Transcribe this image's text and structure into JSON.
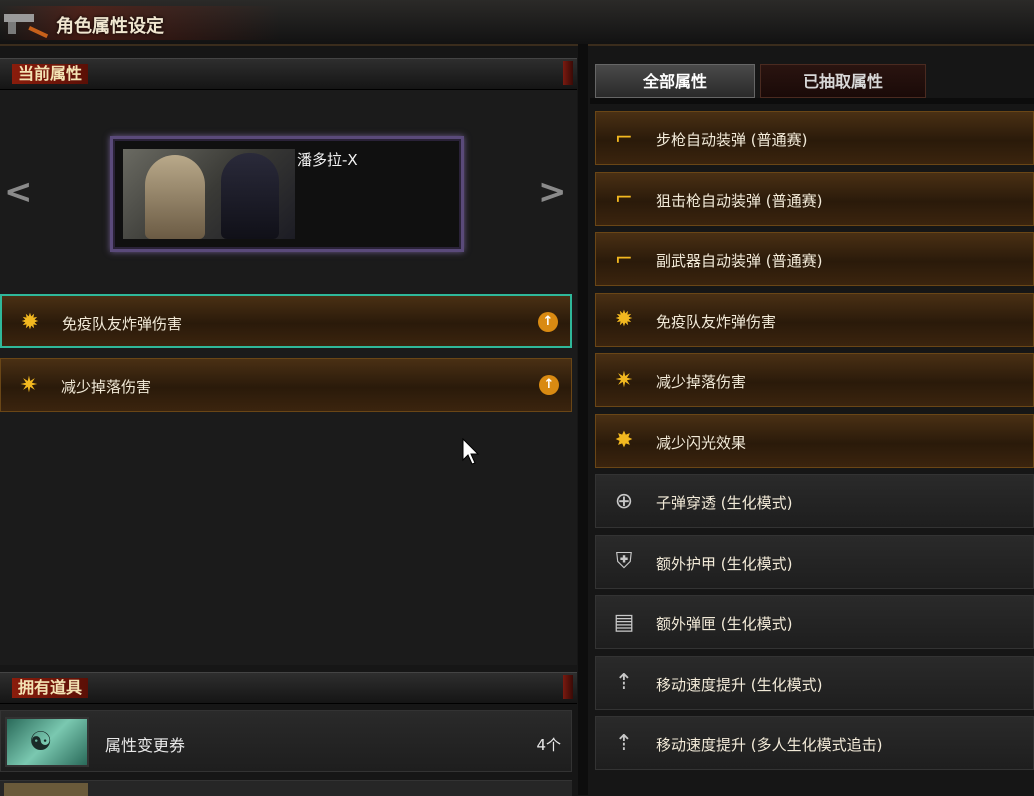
{
  "window": {
    "title": "角色属性设定"
  },
  "current_panel": {
    "header": "当前属性"
  },
  "character": {
    "name": "潘多拉-X",
    "prev_arrow": "<",
    "next_arrow": ">"
  },
  "current_attributes": [
    {
      "label": "免疫队友炸弹伤害",
      "icon": "bomb-burst-icon",
      "upgrade_icon": "upgrade-icon"
    },
    {
      "label": "减少掉落伤害",
      "icon": "fall-damage-icon",
      "upgrade_icon": "upgrade-icon"
    }
  ],
  "tabs": [
    {
      "label": "全部属性",
      "active": true
    },
    {
      "label": "已抽取属性",
      "active": false
    }
  ],
  "all_attributes": [
    {
      "label": "步枪自动装弹 (普通赛)",
      "icon": "rifle-reload-icon",
      "style": "gold"
    },
    {
      "label": "狙击枪自动装弹 (普通赛)",
      "icon": "sniper-reload-icon",
      "style": "gold"
    },
    {
      "label": "副武器自动装弹 (普通赛)",
      "icon": "pistol-reload-icon",
      "style": "gold"
    },
    {
      "label": "免疫队友炸弹伤害",
      "icon": "bomb-burst-icon",
      "style": "gold"
    },
    {
      "label": "减少掉落伤害",
      "icon": "fall-damage-icon",
      "style": "gold"
    },
    {
      "label": "减少闪光效果",
      "icon": "flash-icon",
      "style": "gold"
    },
    {
      "label": "子弹穿透 (生化模式)",
      "icon": "crosshair-icon",
      "style": "plain"
    },
    {
      "label": "额外护甲 (生化模式)",
      "icon": "armor-icon",
      "style": "plain"
    },
    {
      "label": "额外弹匣 (生化模式)",
      "icon": "magazine-icon",
      "style": "plain"
    },
    {
      "label": "移动速度提升 (生化模式)",
      "icon": "speed-icon",
      "style": "plain"
    },
    {
      "label": "移动速度提升 (多人生化模式追击)",
      "icon": "speed-icon",
      "style": "plain"
    }
  ],
  "items_panel": {
    "header": "拥有道具"
  },
  "items": [
    {
      "name": "属性变更券",
      "count": "4个",
      "icon": "ticket-icon"
    }
  ],
  "colors": {
    "accent_gold": "#f2b820",
    "select_outline": "#2fb89a",
    "header_red": "#8a1d0c"
  }
}
